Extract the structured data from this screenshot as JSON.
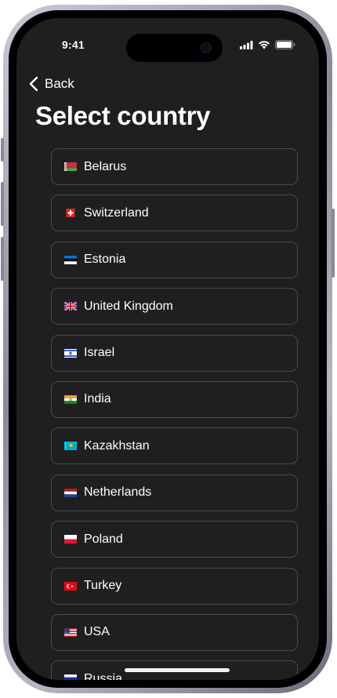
{
  "status_bar": {
    "time": "9:41",
    "icons": [
      "cellular-icon",
      "wifi-icon",
      "battery-icon"
    ]
  },
  "nav": {
    "back_label": "Back",
    "back_icon": "chevron-left-icon"
  },
  "page": {
    "title": "Select country"
  },
  "colors": {
    "background": "#1f1f21",
    "item_border": "#4a4a4e",
    "text": "#ffffff"
  },
  "countries": [
    {
      "name": "Belarus",
      "flag": "belarus-flag-icon"
    },
    {
      "name": "Switzerland",
      "flag": "switzerland-flag-icon"
    },
    {
      "name": "Estonia",
      "flag": "estonia-flag-icon"
    },
    {
      "name": "United Kingdom",
      "flag": "united-kingdom-flag-icon"
    },
    {
      "name": "Israel",
      "flag": "israel-flag-icon"
    },
    {
      "name": "India",
      "flag": "india-flag-icon"
    },
    {
      "name": "Kazakhstan",
      "flag": "kazakhstan-flag-icon"
    },
    {
      "name": "Netherlands",
      "flag": "netherlands-flag-icon"
    },
    {
      "name": "Poland",
      "flag": "poland-flag-icon"
    },
    {
      "name": "Turkey",
      "flag": "turkey-flag-icon"
    },
    {
      "name": "USA",
      "flag": "usa-flag-icon"
    },
    {
      "name": "Russia",
      "flag": "russia-flag-icon"
    }
  ]
}
